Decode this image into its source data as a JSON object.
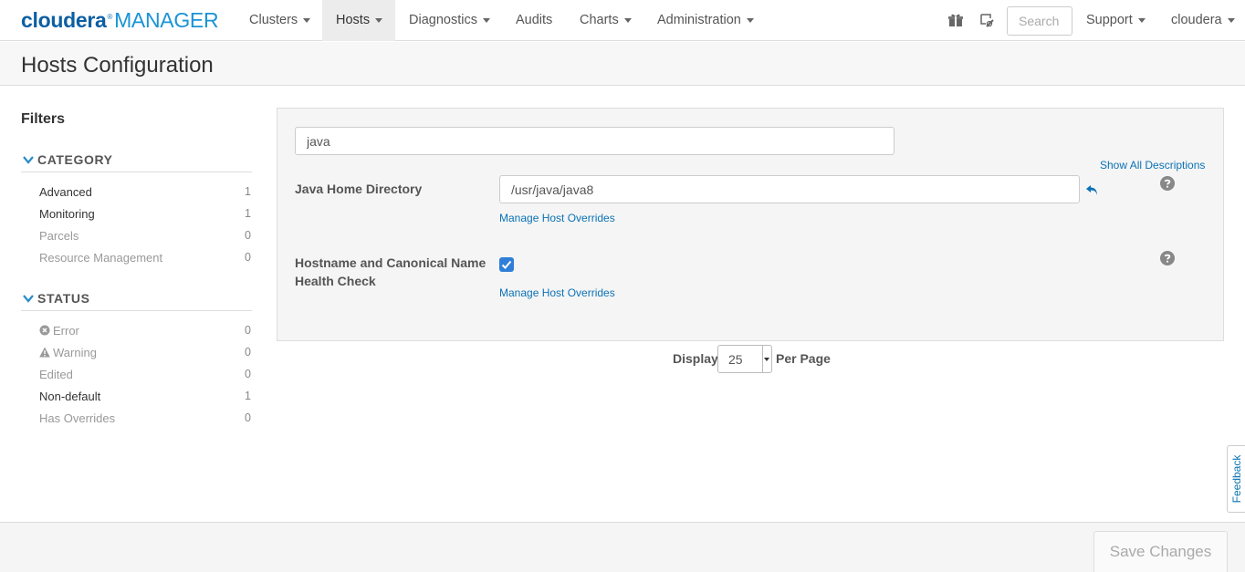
{
  "header": {
    "brand": "cloudera",
    "product": "MANAGER",
    "nav": [
      {
        "label": "Clusters"
      },
      {
        "label": "Hosts"
      },
      {
        "label": "Diagnostics"
      },
      {
        "label": "Audits"
      },
      {
        "label": "Charts"
      },
      {
        "label": "Administration"
      }
    ],
    "active_nav": "Hosts",
    "search_placeholder": "Search",
    "support_label": "Support",
    "user_label": "cloudera",
    "icons": [
      "gift-icon",
      "wizard-icon"
    ]
  },
  "page": {
    "title": "Hosts Configuration"
  },
  "filters": {
    "title": "Filters",
    "category": {
      "label": "CATEGORY",
      "items": [
        {
          "label": "Advanced",
          "count": "1"
        },
        {
          "label": "Monitoring",
          "count": "1"
        },
        {
          "label": "Parcels",
          "count": "0"
        },
        {
          "label": "Resource Management",
          "count": "0"
        }
      ]
    },
    "status": {
      "label": "STATUS",
      "items": [
        {
          "label": "Error",
          "count": "0"
        },
        {
          "label": "Warning",
          "count": "0"
        },
        {
          "label": "Edited",
          "count": "0"
        },
        {
          "label": "Non-default",
          "count": "1"
        },
        {
          "label": "Has Overrides",
          "count": "0"
        }
      ]
    }
  },
  "config": {
    "filter_value": "java",
    "show_all_descriptions": "Show All Descriptions",
    "properties": [
      {
        "label": "Java Home Directory",
        "value": "/usr/java/java8",
        "override_link": "Manage Host Overrides"
      },
      {
        "label": "Hostname and Canonical Name Health Check",
        "checked": true,
        "override_link": "Manage Host Overrides"
      }
    ]
  },
  "pagination": {
    "display_label": "Display",
    "per_page_value": "25",
    "per_page_label": "Per Page"
  },
  "feedback_label": "Feedback",
  "footer": {
    "save_label": "Save Changes"
  },
  "colors": {
    "link": "#0b72b5",
    "brand": "#0d5fa3",
    "checkbox": "#2f7fd8"
  }
}
